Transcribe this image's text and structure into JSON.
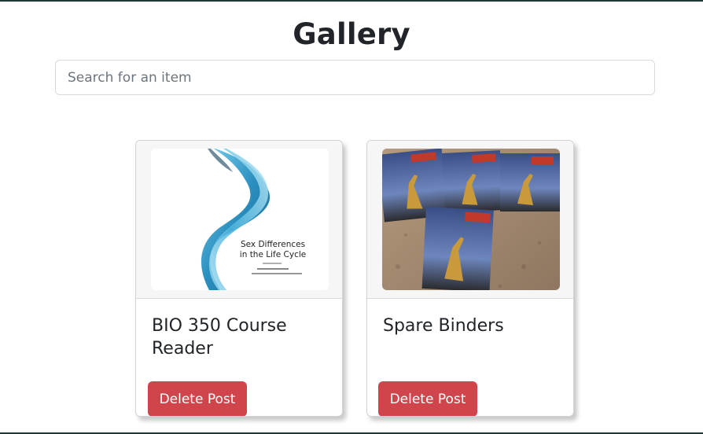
{
  "page": {
    "title": "Gallery"
  },
  "search": {
    "placeholder": "Search for an item"
  },
  "items": [
    {
      "title": "BIO 350 Course Reader",
      "image_icon": "book-cover-image",
      "delete_label": "Delete Post",
      "cover_text": {
        "line1": "Sex Differences",
        "line2": "in the Life Cycle"
      }
    },
    {
      "title": "Spare Binders",
      "image_icon": "binders-photo-image",
      "delete_label": "Delete Post"
    }
  ],
  "colors": {
    "danger": "#d0454c",
    "border": "#d0d4d8",
    "text": "#212529"
  }
}
